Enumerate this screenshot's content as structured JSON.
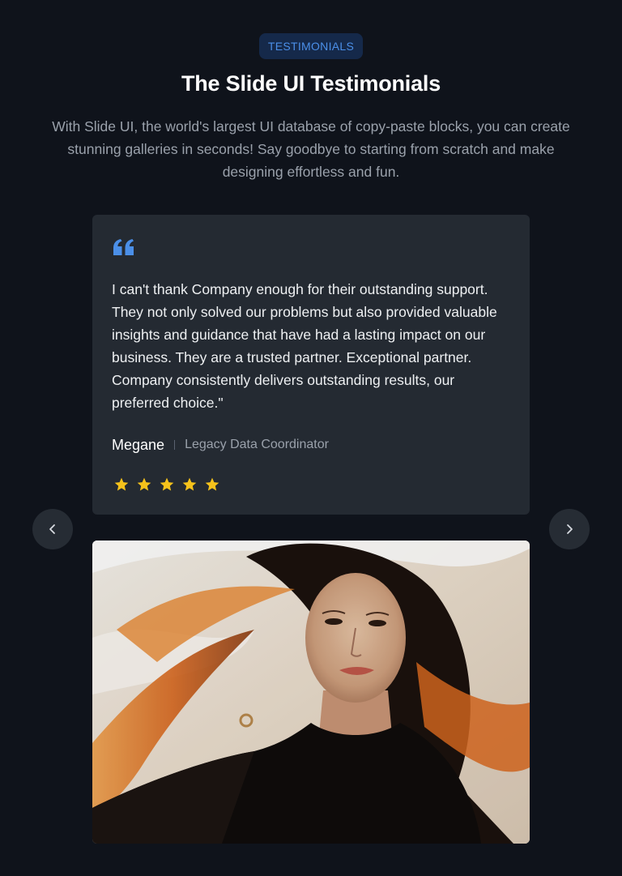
{
  "header": {
    "badge": "TESTIMONIALS",
    "title": "The Slide UI Testimonials",
    "subtitle": "With Slide UI, the world's largest UI database of copy-paste blocks, you can create stunning galleries in seconds! Say goodbye to starting from scratch and make designing effortless and fun."
  },
  "testimonial": {
    "quote": "I can't thank Company enough for their outstanding support. They not only solved our problems but also provided valuable insights and guidance that have had a lasting impact on our business. They are a trusted partner. Exceptional partner. Company consistently delivers outstanding results, our preferred choice.\"",
    "author_name": "Megane",
    "author_role": "Legacy Data Coordinator",
    "rating": 5,
    "rating_max": 5
  },
  "icons": {
    "quote": "quote-icon",
    "star": "star-icon",
    "prev": "chevron-left-icon",
    "next": "chevron-right-icon"
  },
  "colors": {
    "background": "#0f131b",
    "card": "#242a32",
    "accent": "#4b8fe8",
    "badge_bg": "#15294a",
    "star": "#f5c21b",
    "nav_button": "#262c34"
  }
}
